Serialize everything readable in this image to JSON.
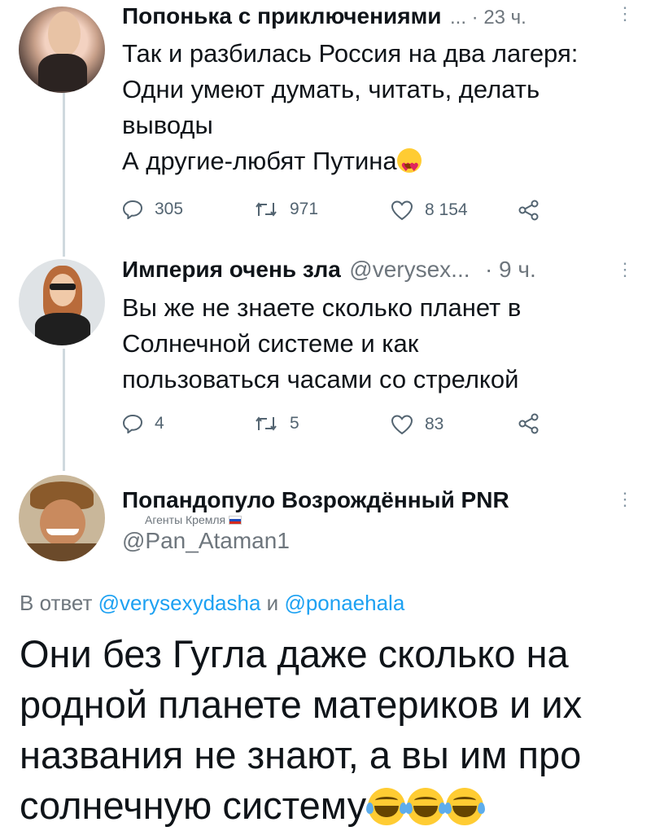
{
  "tweet1": {
    "display_name": "Попонька с приключениями",
    "meta_suffix": "... · 23 ч.",
    "lines": [
      "Так и разбилась Россия на два лагеря:",
      "Одни умеют думать, читать, делать",
      "выводы"
    ],
    "last_line": "А другие-любят Путина",
    "emoji_heart_eyes": "heart-eyes-emoji",
    "reply_count": "305",
    "retweet_count": "971",
    "like_count": "8 154"
  },
  "tweet2": {
    "display_name": "Империя очень зла",
    "handle": "@verysex...",
    "time": "· 9 ч.",
    "lines": [
      "Вы же не знаете сколько планет в",
      "Солнечной системе и как",
      "пользоваться часами со стрелкой"
    ],
    "reply_count": "4",
    "retweet_count": "5",
    "like_count": "83"
  },
  "tweet3": {
    "display_name": "Попандопуло Возрождённый PNR",
    "badge": "Агенты Кремля",
    "handle": "@Pan_Ataman1",
    "reply_prefix": "В ответ",
    "mention1": "@verysexydasha",
    "conjunction": "и",
    "mention2": "@ponaehala",
    "lines": [
      "Они без Гугла даже сколько на",
      "родной планете материков и их",
      "названия не знают, а вы им про"
    ],
    "last_line": "солнечную систему",
    "emoji_laughing": "face-with-tears-of-joy-emoji"
  },
  "colors": {
    "link": "#1da1f2",
    "secondary": "#6e767d",
    "text": "#0f1419",
    "thread_line": "#cfd9de"
  }
}
